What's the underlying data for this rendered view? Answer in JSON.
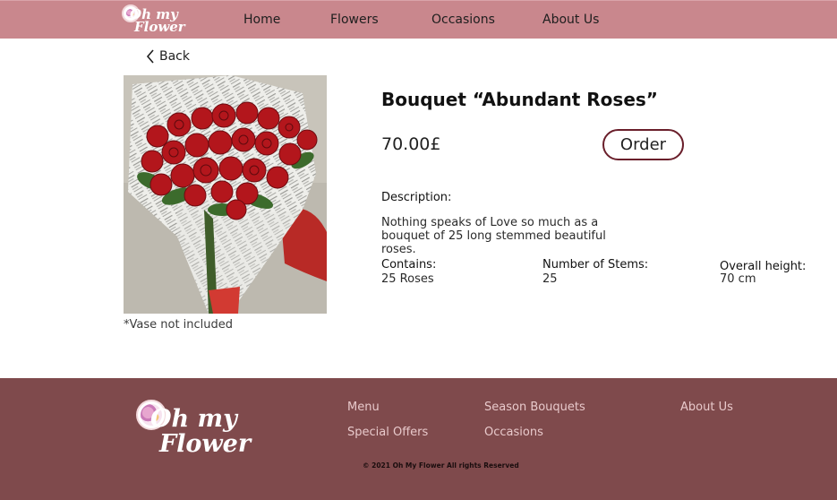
{
  "brand": {
    "line1": "Oh my",
    "line2": "Flower"
  },
  "nav": {
    "items": [
      "Home",
      "Flowers",
      "Occasions",
      "About Us"
    ]
  },
  "back_label": "Back",
  "product": {
    "title": "Bouquet “Abundant Roses”",
    "price": "70.00£",
    "order_label": "Order",
    "description_label": "Description:",
    "description": "Nothing speaks of Love so much as a bouquet of 25 long stemmed beautiful roses.",
    "contains_label": "Contains:",
    "contains_value": "25 Roses",
    "stems_label": "Number of Stems:",
    "stems_value": "25",
    "height_label": "Overall height:",
    "height_value": "70 cm",
    "vase_note": "*Vase not included",
    "image_icon": "rose-bouquet-photo"
  },
  "footer": {
    "links": [
      "Menu",
      "Season Bouquets",
      "About Us",
      "Special Offers",
      "Occasions"
    ],
    "copyright": "© 2021  Oh My Flower All rights Reserved"
  },
  "colors": {
    "header_bg": "#c9878d",
    "footer_bg": "#7f4a4c",
    "order_border": "#6a1f2b",
    "footer_link": "#e8c9cb"
  }
}
